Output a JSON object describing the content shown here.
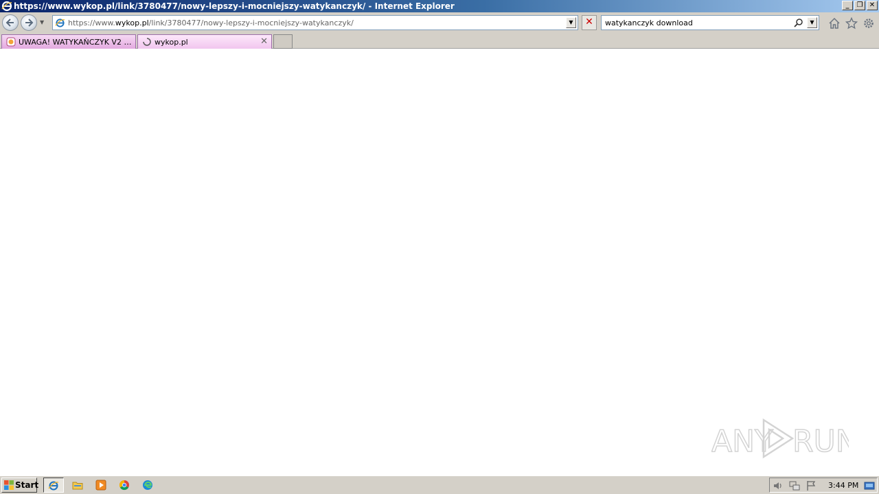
{
  "window": {
    "title": "https://www.wykop.pl/link/3780477/nowy-lepszy-i-mocniejszy-watykanczyk/ - Internet Explorer",
    "controls": [
      "_",
      "❐",
      "✕"
    ]
  },
  "navbar": {
    "address": {
      "prefix": "https://www.",
      "domain": "wykop.pl",
      "path": "/link/3780477/nowy-lepszy-i-mocniejszy-watykanczyk/"
    },
    "search_query": "watykanczyk download"
  },
  "tabs": [
    {
      "label": "UWAGA! WATYKAŃCZYK V2 dru...",
      "active": false
    },
    {
      "label": "wykop.pl",
      "active": true,
      "loading": true
    }
  ],
  "watermark": {
    "text_left": "ANY",
    "text_right": "RUN"
  },
  "taskbar": {
    "start_label": "Start",
    "apps": [
      "internet-explorer",
      "file-explorer",
      "media-player",
      "chrome",
      "edge"
    ],
    "clock": "3:44 PM"
  }
}
